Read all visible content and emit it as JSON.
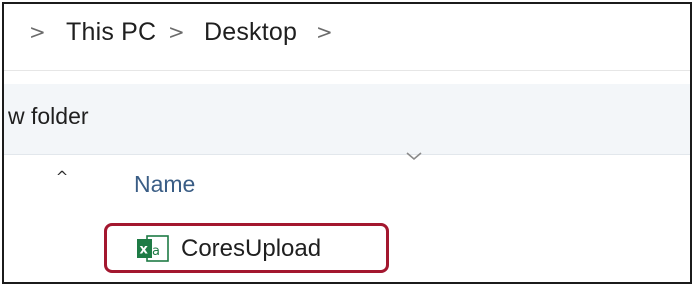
{
  "breadcrumb": {
    "items": [
      "This PC",
      "Desktop"
    ],
    "separator": ">"
  },
  "toolbar": {
    "new_folder_label": "w folder"
  },
  "file_list": {
    "columns": [
      {
        "name": "Name"
      }
    ],
    "scroll_up_glyph": "^",
    "files": [
      {
        "name": "CoresUpload",
        "icon": "excel-csv-file-icon",
        "highlighted": true
      }
    ]
  },
  "colors": {
    "highlight_border": "#a3172f",
    "excel_green": "#1e7b45",
    "column_header_text": "#3a5d85",
    "command_bar_bg": "#f3f6f9"
  }
}
